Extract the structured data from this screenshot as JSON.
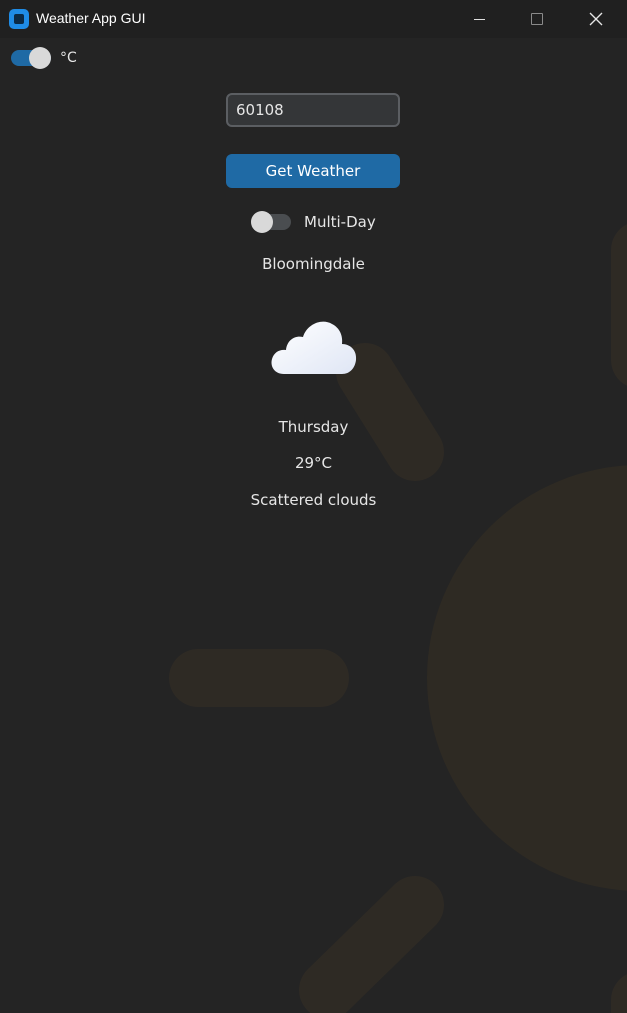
{
  "window": {
    "title": "Weather App GUI"
  },
  "unit_toggle": {
    "label": "°C",
    "on": true
  },
  "search": {
    "value": "60108"
  },
  "get_weather": {
    "label": "Get Weather"
  },
  "multi_day": {
    "label": "Multi-Day",
    "on": false
  },
  "result": {
    "city": "Bloomingdale",
    "weather_icon": "cloud-icon",
    "day": "Thursday",
    "temperature": "29°C",
    "description": "Scattered clouds"
  },
  "colors": {
    "accent": "#1f6aa5",
    "background": "#242424",
    "titlebar": "#202020",
    "sun_decoration": "#2e2a23"
  }
}
